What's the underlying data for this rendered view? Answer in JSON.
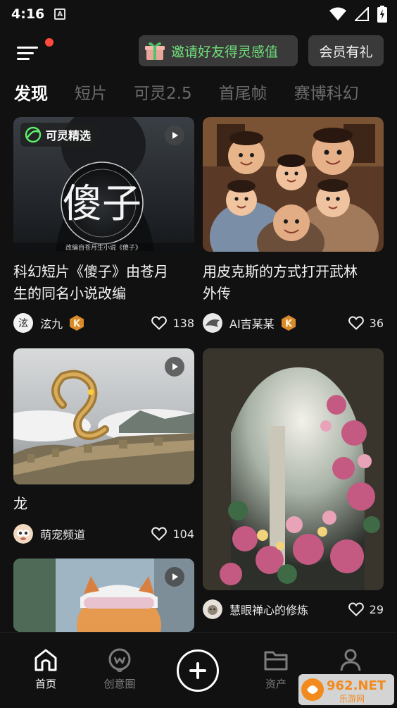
{
  "status_bar": {
    "time": "4:16",
    "notification_glyph": "A"
  },
  "header": {
    "invite_label": "邀请好友得灵感值",
    "vip_label": "会员有礼"
  },
  "tabs": [
    {
      "label": "发现",
      "active": true
    },
    {
      "label": "短片",
      "active": false
    },
    {
      "label": "可灵2.5",
      "active": false
    },
    {
      "label": "首尾帧",
      "active": false
    },
    {
      "label": "赛博科幻",
      "active": false
    }
  ],
  "feed": [
    {
      "badge": "可灵精选",
      "thumb_caption": "改编自苍月生小说《傻子》",
      "poster_text": "傻子",
      "title_line1": "科幻短片《傻子》由苍月",
      "title_line2": "生的同名小说改编",
      "author": "泫九",
      "verified": "K",
      "likes": "138",
      "avatar_text": "泫"
    },
    {
      "title_line1": "用皮克斯的方式打开武林",
      "title_line2": "外传",
      "author": "AI吉某某",
      "verified": "K",
      "likes": "36"
    },
    {
      "title_line1": "龙",
      "author": "萌宠频道",
      "likes": "104"
    },
    {
      "author": "慧眼禅心的修炼",
      "likes": "29"
    }
  ],
  "bottom_nav": {
    "home": "首页",
    "creative": "创意圈",
    "assets": "资产"
  },
  "watermark": {
    "brand": "962.NET",
    "sub": "乐游网"
  },
  "colors": {
    "accent_green": "#6fe07b",
    "dot_red": "#ff4a3b",
    "badge_orange": "#d98a2b"
  }
}
